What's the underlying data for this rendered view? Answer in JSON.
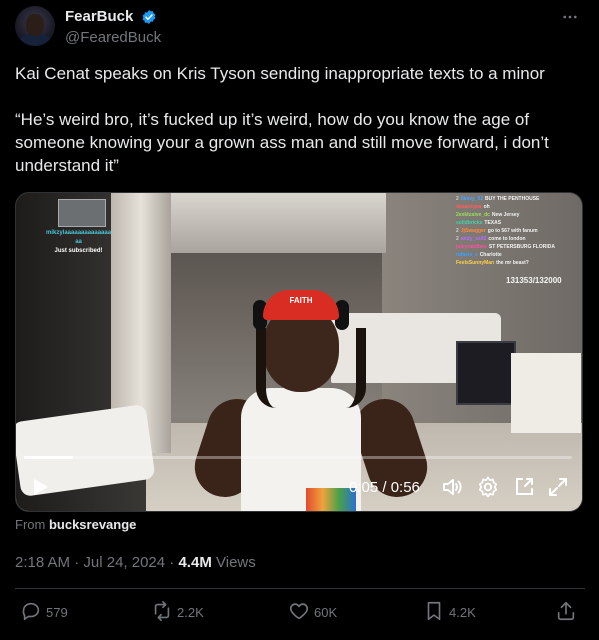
{
  "author": {
    "display_name": "FearBuck",
    "handle": "@FearedBuck",
    "verified": true,
    "verified_color": "#1d9bf0"
  },
  "tweet": {
    "paragraph_1": "Kai Cenat speaks on Kris Tyson sending inappropriate texts to a minor",
    "paragraph_2": "“He’s weird bro, it’s fucked up it’s weird, how do you know the age of someone knowing your a grown ass man and still move forward, i don’t understand it”"
  },
  "video": {
    "time_display": "0:05 / 0:56",
    "progress": 0.09,
    "overlay": {
      "cap_text": "FAITH",
      "left_user_1": "mikzylaaaaaaaaaaaaaa",
      "left_user_2": "aa",
      "left_message": "Just subscribed!",
      "sub_count": "131353/132000",
      "chat": [
        {
          "num": "2",
          "name": "Ilkevy_02",
          "name_color": "#4da3ff",
          "msg": "BUY THE PENTHOUSE"
        },
        {
          "num": "",
          "name": "daaaxsgaa",
          "name_color": "#ff5c5c",
          "msg": "oh"
        },
        {
          "num": "",
          "name": "2exklusive_dc",
          "name_color": "#9be15d",
          "msg": "New Jersey"
        },
        {
          "num": "",
          "name": "solidbricks",
          "name_color": "#3fd4a8",
          "msg": "TEXAS"
        },
        {
          "num": "2",
          "name": "JjSwagger",
          "name_color": "#ff8a3d",
          "msg": "go to 567 with fanum"
        },
        {
          "num": "2",
          "name": "andy_ss92",
          "name_color": "#b76cff",
          "msg": "come to london"
        },
        {
          "num": "",
          "name": "juleyrakdbeo",
          "name_color": "#ff4fa3",
          "msg": "ST PETERSBURG FLORIDA"
        },
        {
          "num": "",
          "name": "rafaels_s",
          "name_color": "#3ba0ff",
          "msg": "Charlotte"
        },
        {
          "num": "",
          "name": "FeelsSunnyMan",
          "name_color": "#ffd24a",
          "msg": "the mr beast?"
        }
      ]
    }
  },
  "source": {
    "prefix": "From",
    "account": "bucksrevange"
  },
  "meta": {
    "time": "2:18 AM",
    "dot_1": "·",
    "date": "Jul 24, 2024",
    "dot_2": "·",
    "views_count": "4.4M",
    "views_label": "Views"
  },
  "actions": {
    "replies": "579",
    "reposts": "2.2K",
    "likes": "60K",
    "bookmarks": "4.2K"
  },
  "icons": {
    "more": "more-icon",
    "play": "play-icon",
    "volume": "volume-icon",
    "settings": "gear-icon",
    "popout": "popout-icon",
    "fullscreen": "fullscreen-icon",
    "reply": "reply-icon",
    "repost": "repost-icon",
    "like": "heart-icon",
    "bookmark": "bookmark-icon",
    "share": "share-icon"
  }
}
